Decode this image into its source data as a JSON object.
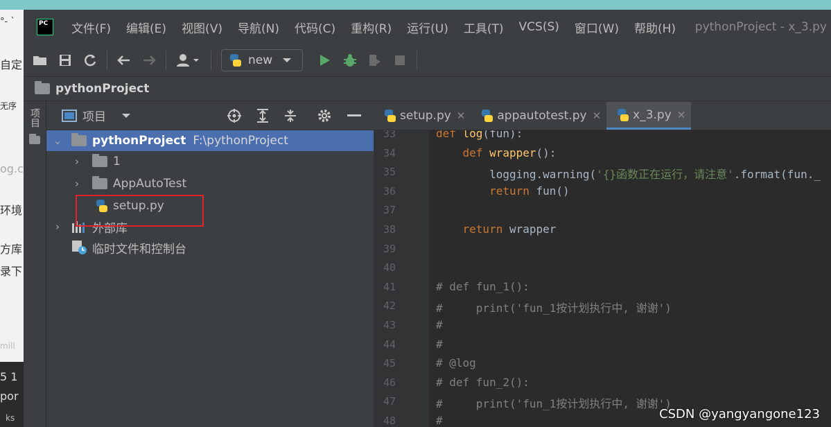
{
  "background": {
    "left_texts": [
      "°- `",
      "自定",
      "无序",
      "og.c",
      "环境",
      "方库",
      "录下",
      "mill",
      "5 1",
      "por",
      "ks"
    ]
  },
  "menu": {
    "logo": "PC",
    "items": [
      "文件(F)",
      "编辑(E)",
      "视图(V)",
      "导航(N)",
      "代码(C)",
      "重构(R)",
      "运行(U)",
      "工具(T)",
      "VCS(S)",
      "窗口(W)",
      "帮助(H)"
    ],
    "window_title": "pythonProject - x_3.py"
  },
  "toolbar": {
    "run_config": "new"
  },
  "navbar": {
    "project": "pythonProject"
  },
  "sidebar": {
    "vertical_label": "项目"
  },
  "project_panel": {
    "title": "项目",
    "root": {
      "name": "pythonProject",
      "path": "F:\\pythonProject"
    },
    "items": [
      {
        "label": "1"
      },
      {
        "label": "AppAutoTest"
      },
      {
        "label": "setup.py"
      },
      {
        "label": "外部库"
      },
      {
        "label": "临时文件和控制台"
      }
    ]
  },
  "tabs": [
    {
      "label": "setup.py"
    },
    {
      "label": "appautotest.py"
    },
    {
      "label": "x_3.py"
    }
  ],
  "editor": {
    "lines": [
      {
        "n": "33",
        "parts": [
          [
            "kw",
            "def "
          ],
          [
            "fn",
            "log"
          ],
          [
            "tx",
            "(fun):"
          ]
        ]
      },
      {
        "n": "34",
        "parts": [
          [
            "tx",
            "    "
          ],
          [
            "kw",
            "def "
          ],
          [
            "fn",
            "wrapper"
          ],
          [
            "tx",
            "():"
          ]
        ]
      },
      {
        "n": "35",
        "parts": [
          [
            "tx",
            "        logging.warning("
          ],
          [
            "st",
            "'{}函数正在运行，请注意'"
          ],
          [
            "tx",
            ".format(fun._"
          ]
        ]
      },
      {
        "n": "36",
        "parts": [
          [
            "tx",
            "        "
          ],
          [
            "kw",
            "return "
          ],
          [
            "tx",
            "fun()"
          ]
        ]
      },
      {
        "n": "37",
        "parts": []
      },
      {
        "n": "38",
        "parts": [
          [
            "tx",
            "    "
          ],
          [
            "kw",
            "return "
          ],
          [
            "tx",
            "wrapper"
          ]
        ]
      },
      {
        "n": "39",
        "parts": []
      },
      {
        "n": "40",
        "parts": []
      },
      {
        "n": "41",
        "parts": [
          [
            "cm",
            "# def fun_1():"
          ]
        ]
      },
      {
        "n": "42",
        "parts": [
          [
            "cm",
            "#     print('fun_1按计划执行中, 谢谢')"
          ]
        ]
      },
      {
        "n": "43",
        "parts": [
          [
            "cm",
            "#"
          ]
        ]
      },
      {
        "n": "44",
        "parts": [
          [
            "cm",
            "#"
          ]
        ]
      },
      {
        "n": "45",
        "parts": [
          [
            "cm",
            "# @log"
          ]
        ]
      },
      {
        "n": "46",
        "parts": [
          [
            "cm",
            "# def fun_2():"
          ]
        ]
      },
      {
        "n": "47",
        "parts": [
          [
            "cm",
            "#     print('fun_1按计划执行中, 谢谢')"
          ]
        ]
      },
      {
        "n": "48",
        "parts": [
          [
            "cm",
            "#"
          ]
        ]
      }
    ]
  },
  "watermark": "CSDN @yangyangone123"
}
